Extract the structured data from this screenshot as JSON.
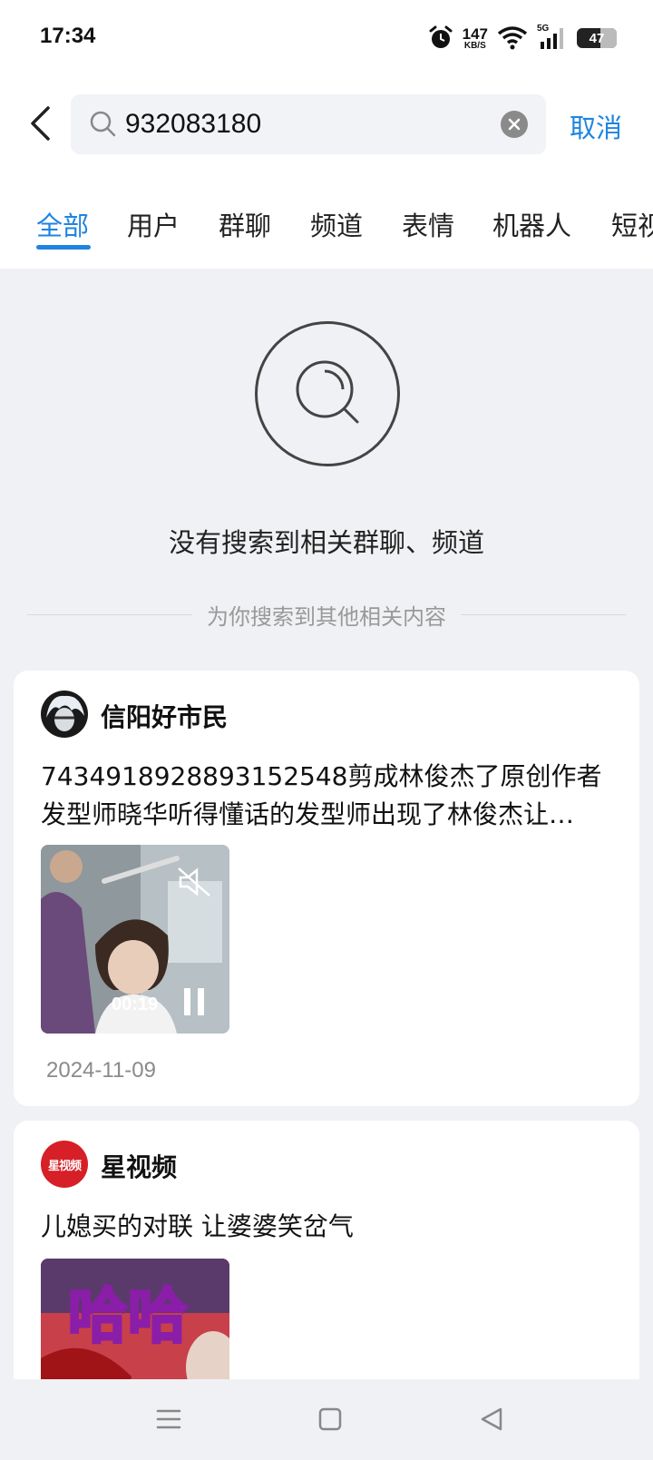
{
  "status_bar": {
    "time": "17:34",
    "net_speed_value": "147",
    "net_speed_unit": "KB/S",
    "network": "5G",
    "battery": "47",
    "icons": [
      "alarm-icon",
      "wifi-icon",
      "signal-icon",
      "battery-icon"
    ]
  },
  "search": {
    "query": "932083180",
    "cancel_label": "取消"
  },
  "tabs": [
    {
      "label": "全部",
      "active": true
    },
    {
      "label": "用户"
    },
    {
      "label": "群聊"
    },
    {
      "label": "频道"
    },
    {
      "label": "表情"
    },
    {
      "label": "机器人"
    },
    {
      "label": "短视"
    }
  ],
  "empty_state": {
    "message": "没有搜索到相关群聊、频道",
    "divider_text": "为你搜索到其他相关内容"
  },
  "results": [
    {
      "author": "信阳好市民",
      "text": "7434918928893152548剪成林俊杰了原创作者发型师晓华听得懂话的发型师出现了林俊杰让…",
      "duration": "00:19",
      "date": "2024-11-09"
    },
    {
      "author": "星视频",
      "avatar_text": "星视频",
      "text": "儿媳买的对联 让婆婆笑岔气",
      "thumb_text": "哈哈"
    }
  ],
  "colors": {
    "accent": "#1f84e0",
    "page_bg": "#f0f1f4",
    "card_bg": "#ffffff"
  }
}
